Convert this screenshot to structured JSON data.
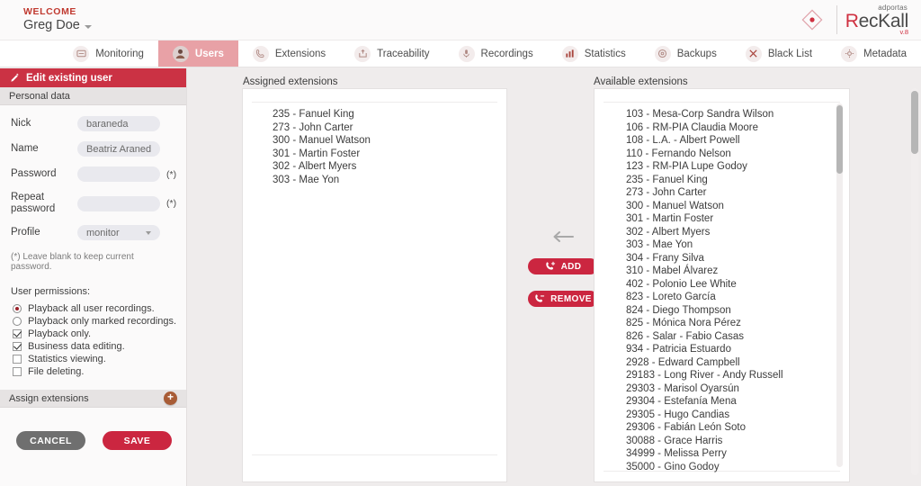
{
  "topbar": {
    "welcome_label": "WELCOME",
    "user_name": "Greg Doe",
    "brand_prefix": "adportas",
    "brand_name_first": "R",
    "brand_name_rest": "ecKall",
    "brand_version": "v.8"
  },
  "nav": {
    "items": [
      {
        "label": "Monitoring",
        "icon": "monitor-screen-icon",
        "active": false
      },
      {
        "label": "Users",
        "icon": "user-avatar-icon",
        "active": true
      },
      {
        "label": "Extensions",
        "icon": "phone-handset-icon",
        "active": false
      },
      {
        "label": "Traceability",
        "icon": "upload-tray-icon",
        "active": false
      },
      {
        "label": "Recordings",
        "icon": "microphone-icon",
        "active": false
      },
      {
        "label": "Statistics",
        "icon": "bar-chart-icon",
        "active": false
      },
      {
        "label": "Backups",
        "icon": "disc-target-icon",
        "active": false
      },
      {
        "label": "Black List",
        "icon": "scissors-icon",
        "active": false
      },
      {
        "label": "Metadata",
        "icon": "gear-icon",
        "active": false
      }
    ]
  },
  "sidebar": {
    "header": "Edit existing user",
    "personal_data_header": "Personal data",
    "fields": [
      {
        "label": "Nick",
        "value": "baraneda",
        "required_mark": ""
      },
      {
        "label": "Name",
        "value": "Beatriz Araneda",
        "required_mark": ""
      },
      {
        "label": "Password",
        "value": "",
        "required_mark": "(*)"
      },
      {
        "label": "Repeat password",
        "value": "",
        "required_mark": "(*)"
      }
    ],
    "profile": {
      "label": "Profile",
      "value": "monitor"
    },
    "hint": "(*) Leave blank to keep current password.",
    "permissions_title": "User permissions:",
    "permissions": [
      {
        "label": "Playback all user recordings.",
        "type": "radio",
        "checked": true
      },
      {
        "label": "Playback only marked recordings.",
        "type": "radio",
        "checked": false
      },
      {
        "label": "Playback only.",
        "type": "checkbox",
        "checked": true
      },
      {
        "label": "Business data editing.",
        "type": "checkbox",
        "checked": true
      },
      {
        "label": "Statistics viewing.",
        "type": "checkbox",
        "checked": false
      },
      {
        "label": "File deleting.",
        "type": "checkbox",
        "checked": false
      }
    ],
    "assign_header": "Assign extensions",
    "assign_add_symbol": "+",
    "cancel_label": "CANCEL",
    "save_label": "SAVE"
  },
  "assigned": {
    "title": "Assigned extensions",
    "items": [
      "235 - Fanuel King",
      "273 - John Carter",
      "300 - Manuel Watson",
      "301 - Martin Foster",
      "302 - Albert Myers",
      "303 - Mae Yon"
    ]
  },
  "available": {
    "title": "Available extensions",
    "items": [
      "103 - Mesa-Corp Sandra Wilson",
      "106 - RM-PIA Claudia Moore",
      "108 - L.A. - Albert Powell",
      "110 - Fernando Nelson",
      "123 - RM-PIA Lupe Godoy",
      "235 - Fanuel King",
      "273 - John Carter",
      "300 - Manuel Watson",
      "301 - Martin Foster",
      "302 - Albert Myers",
      "303 - Mae Yon",
      "304 - Frany Silva",
      "310 - Mabel Álvarez",
      "402 - Polonio Lee White",
      "823 - Loreto García",
      "824 - Diego Thompson",
      "825 - Mónica Nora Pérez",
      "826 - Salar - Fabio Casas",
      "934 - Patricia Estuardo",
      "2928 - Edward Campbell",
      "29183 - Long River - Andy Russell",
      "29303 - Marisol Oyarsún",
      "29304 - Estefanía Mena",
      "29305 - Hugo Candias",
      "29306 - Fabián León Soto",
      "30088 - Grace Harris",
      "34999 - Melissa Perry",
      "35000 - Gino Godoy"
    ]
  },
  "transfer": {
    "add_label": "ADD",
    "remove_label": "REMOVE"
  },
  "colors": {
    "accent_red": "#cb2640",
    "header_red": "#cb3244",
    "active_tab": "#e8a1a6",
    "plus_brown": "#a85c36",
    "cancel_gray": "#6f6f6f"
  }
}
